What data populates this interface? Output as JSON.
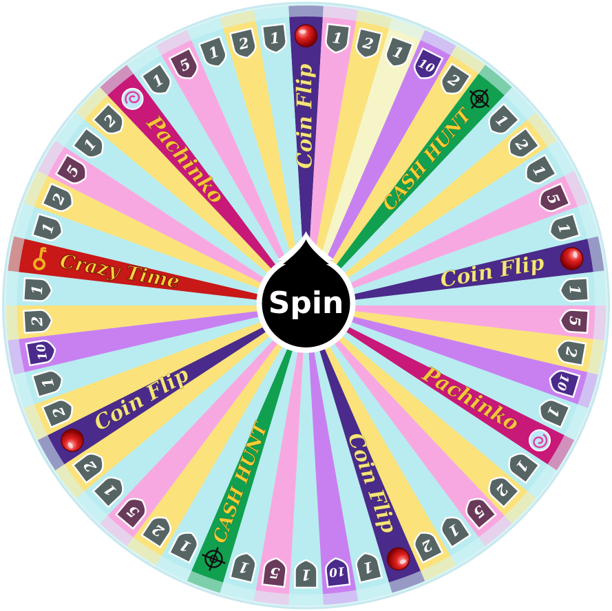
{
  "wheel": {
    "spin_label": "Spin",
    "segments": [
      {
        "kind": "bonus",
        "value": "",
        "icon": "red-ball",
        "label": "Coin Flip",
        "color": "#4a2a8a"
      },
      {
        "kind": "number",
        "value": "1",
        "color": "#f8a8e0"
      },
      {
        "kind": "number",
        "value": "2",
        "color": "#fbe27a"
      },
      {
        "kind": "number",
        "value": "1",
        "color": "#f5f5c8"
      },
      {
        "kind": "number",
        "value": "10",
        "color": "#c880f0"
      },
      {
        "kind": "number",
        "value": "2",
        "color": "#fbe27a"
      },
      {
        "kind": "bonus",
        "value": "",
        "icon": "target",
        "label": "CASH HUNT",
        "color": "#10a050"
      },
      {
        "kind": "number",
        "value": "1",
        "color": "#b8ecf0"
      },
      {
        "kind": "number",
        "value": "2",
        "color": "#fbe27a"
      },
      {
        "kind": "number",
        "value": "1",
        "color": "#b8ecf0"
      },
      {
        "kind": "number",
        "value": "5",
        "color": "#f8a8e0"
      },
      {
        "kind": "number",
        "value": "1",
        "color": "#b8ecf0"
      },
      {
        "kind": "bonus",
        "value": "",
        "icon": "red-ball",
        "label": "Coin Flip",
        "color": "#4a2a8a"
      },
      {
        "kind": "number",
        "value": "1",
        "color": "#b8ecf0"
      },
      {
        "kind": "number",
        "value": "5",
        "color": "#f8a8e0"
      },
      {
        "kind": "number",
        "value": "2",
        "color": "#fbe27a"
      },
      {
        "kind": "number",
        "value": "10",
        "color": "#c880f0"
      },
      {
        "kind": "number",
        "value": "1",
        "color": "#b8ecf0"
      },
      {
        "kind": "bonus",
        "value": "",
        "icon": "swirl",
        "label": "Pachinko",
        "color": "#c81878"
      },
      {
        "kind": "number",
        "value": "1",
        "color": "#b8ecf0"
      },
      {
        "kind": "number",
        "value": "2",
        "color": "#fbe27a"
      },
      {
        "kind": "number",
        "value": "5",
        "color": "#f8a8e0"
      },
      {
        "kind": "number",
        "value": "1",
        "color": "#b8ecf0"
      },
      {
        "kind": "number",
        "value": "2",
        "color": "#fbe27a"
      },
      {
        "kind": "bonus",
        "value": "",
        "icon": "red-ball",
        "label": "Coin Flip",
        "color": "#4a2a8a"
      },
      {
        "kind": "number",
        "value": "1",
        "color": "#b8ecf0"
      },
      {
        "kind": "number",
        "value": "10",
        "color": "#c880f0"
      },
      {
        "kind": "number",
        "value": "1",
        "color": "#b8ecf0"
      },
      {
        "kind": "number",
        "value": "5",
        "color": "#f8a8e0"
      },
      {
        "kind": "number",
        "value": "1",
        "color": "#b8ecf0"
      },
      {
        "kind": "bonus",
        "value": "",
        "icon": "target",
        "label": "CASH HUNT",
        "color": "#10a050"
      },
      {
        "kind": "number",
        "value": "1",
        "color": "#b8ecf0"
      },
      {
        "kind": "number",
        "value": "2",
        "color": "#fbe27a"
      },
      {
        "kind": "number",
        "value": "5",
        "color": "#f8a8e0"
      },
      {
        "kind": "number",
        "value": "1",
        "color": "#b8ecf0"
      },
      {
        "kind": "number",
        "value": "2",
        "color": "#fbe27a"
      },
      {
        "kind": "bonus",
        "value": "",
        "icon": "red-ball",
        "label": "Coin Flip",
        "color": "#4a2a8a"
      },
      {
        "kind": "number",
        "value": "2",
        "color": "#fbe27a"
      },
      {
        "kind": "number",
        "value": "1",
        "color": "#b8ecf0"
      },
      {
        "kind": "number",
        "value": "10",
        "color": "#c880f0"
      },
      {
        "kind": "number",
        "value": "2",
        "color": "#fbe27a"
      },
      {
        "kind": "number",
        "value": "1",
        "color": "#b8ecf0"
      },
      {
        "kind": "bonus",
        "value": "",
        "icon": "key",
        "label": "Crazy Time",
        "color": "#c81818"
      },
      {
        "kind": "number",
        "value": "1",
        "color": "#b8ecf0"
      },
      {
        "kind": "number",
        "value": "2",
        "color": "#fbe27a"
      },
      {
        "kind": "number",
        "value": "5",
        "color": "#f8a8e0"
      },
      {
        "kind": "number",
        "value": "1",
        "color": "#b8ecf0"
      },
      {
        "kind": "number",
        "value": "2",
        "color": "#fbe27a"
      },
      {
        "kind": "bonus",
        "value": "",
        "icon": "swirl",
        "label": "Pachinko",
        "color": "#c81878"
      },
      {
        "kind": "number",
        "value": "1",
        "color": "#b8ecf0"
      },
      {
        "kind": "number",
        "value": "5",
        "color": "#f8a8e0"
      },
      {
        "kind": "number",
        "value": "1",
        "color": "#b8ecf0"
      },
      {
        "kind": "number",
        "value": "2",
        "color": "#fbe27a"
      },
      {
        "kind": "number",
        "value": "1",
        "color": "#b8ecf0"
      }
    ],
    "colors": {
      "rim": "#d8f4f6",
      "rim_edge": "#c8e8ee",
      "badge_number": "#566464",
      "badge_five": "#6a3a5a",
      "badge_ten": "#4a2a8a",
      "badge_text": "#ffffff",
      "hub": "#000000",
      "hub_ring": "#ffffff",
      "spin_text": "#ffffff",
      "coin_flip_text": "#f6e47a",
      "pachinko_text": "#f7c63a",
      "cash_hunt_text": "#ffcc33",
      "crazy_time_text": "#ffd040"
    }
  }
}
